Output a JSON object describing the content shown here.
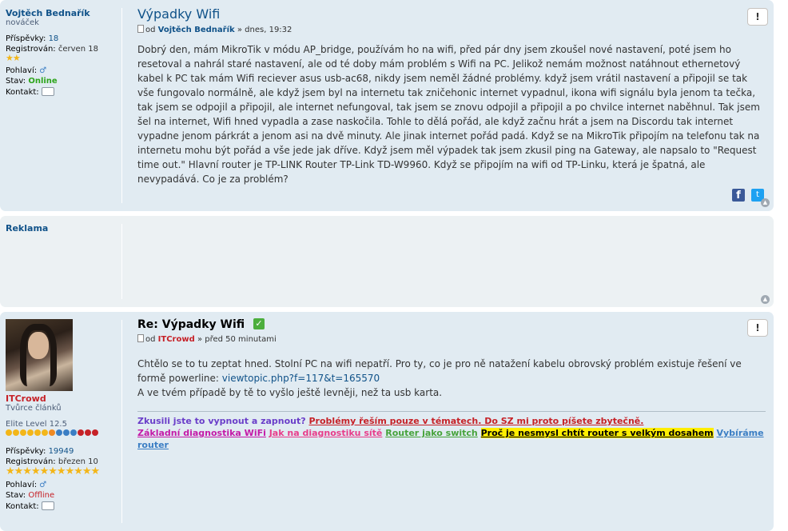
{
  "post1": {
    "username": "Vojtěch Bednařík",
    "rank": "nováček",
    "posts_label": "Příspěvky:",
    "posts_value": "18",
    "registered_label": "Registrován:",
    "registered_value": "červen 18",
    "stars": "★★",
    "gender_label": "Pohlaví:",
    "gender_icon": "♂",
    "status_label": "Stav:",
    "status_value": "Online",
    "contact_label": "Kontakt:",
    "title": "Výpadky Wifi",
    "author_prefix": "od",
    "author": "Vojtěch Bednařík",
    "date": "» dnes, 19:32",
    "body": "Dobrý den, mám MikroTik v módu AP_bridge, používám ho na wifi, před pár dny jsem zkoušel nové nastavení, poté jsem ho resetoval a nahrál staré nastavení, ale od té doby mám problém s Wifi na PC. Jelikož nemám možnost natáhnout ethernetový kabel k PC tak mám Wifi reciever asus usb-ac68, nikdy jsem neměl žádné problémy. když jsem vrátil nastavení a připojil se tak vše fungovalo normálně, ale když jsem byl na internetu tak zničehonic internet vypadnul, ikona wifi signálu byla jenom ta tečka, tak jsem se odpojil a připojil, ale internet nefungoval, tak jsem se znovu odpojil a připojil a po chvilce internet naběhnul. Tak jsem šel na internet, Wifi hned vypadla a zase naskočila. Tohle to dělá pořád, ale když začnu hrát a jsem na Discordu tak internet vypadne jenom párkrát a jenom asi na dvě minuty. Ale jinak internet pořád padá. Když se na MikroTik připojím na telefonu tak na internetu mohu být pořád a vše jede jak dříve. Když jsem měl výpadek tak jsem zkusil ping na Gateway, ale napsalo to \"Request time out.\" Hlavní router je TP-LINK Router TP-Link TD-W9960. Když se připojím na wifi od TP-Linku, která je špatná, ale nevypadává. Co je za problém?",
    "report": "!"
  },
  "ad": {
    "label": "Reklama"
  },
  "post2": {
    "username": "ITCrowd",
    "rank": "Tvůrce článků",
    "level": "Elite Level 12.5",
    "posts_label": "Příspěvky:",
    "posts_value": "19949",
    "registered_label": "Registrován:",
    "registered_value": "březen 10",
    "stars": "★★★★★★★★★★★",
    "gender_label": "Pohlaví:",
    "gender_icon": "♂",
    "status_label": "Stav:",
    "status_value": "Offline",
    "contact_label": "Kontakt:",
    "title": "Re: Výpadky Wifi",
    "accepted_icon": "✓",
    "author_prefix": "od",
    "author": "ITCrowd",
    "date": "» před 50 minutami",
    "body1": "Chtělo se to tu zeptat hned. Stolní PC na wifi nepatří. Pro ty, co je pro ně natažení kabelu obrovský problém existuje řešení ve formě powerline:",
    "link": "viewtopic.php?f=117&t=165570",
    "body2": "A ve tvém případě by tě to vyšlo ještě levněji, než ta usb karta.",
    "sig": {
      "s1": "Zkusili jste to vypnout a zapnout?",
      "s2": "Problémy řeším pouze v tématech. Do SZ mi proto píšete zbytečně.",
      "s3": "Základní diagnostika WiFi",
      "s4": "Jak na diagnostiku sítě",
      "s5": "Router jako switch",
      "s6": "Proč je nesmysl chtít router s velkým dosahem",
      "s7": "Vybíráme router"
    },
    "report": "!"
  },
  "colors": {
    "link": "#105289",
    "online": "#2ea51c",
    "offline": "#c62127",
    "panel": "#e1ebf2"
  }
}
